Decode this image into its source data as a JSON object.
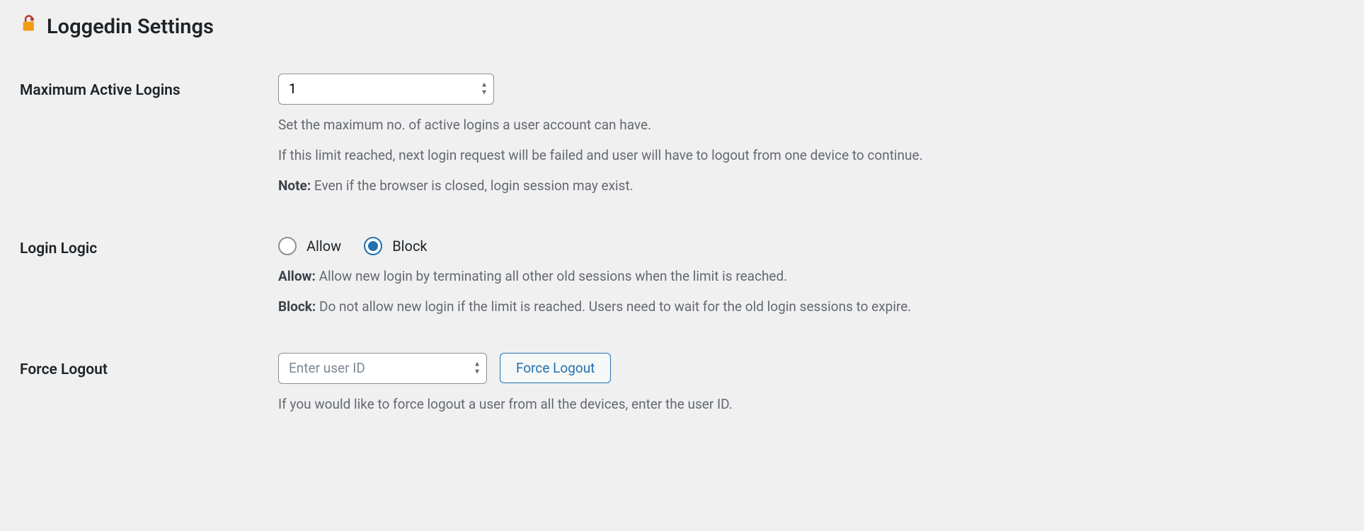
{
  "page": {
    "title": "Loggedin Settings"
  },
  "maxLogins": {
    "label": "Maximum Active Logins",
    "value": "1",
    "desc1": "Set the maximum no. of active logins a user account can have.",
    "desc2": "If this limit reached, next login request will be failed and user will have to logout from one device to continue.",
    "noteLabel": "Note:",
    "noteText": " Even if the browser is closed, login session may exist."
  },
  "loginLogic": {
    "label": "Login Logic",
    "allowOption": "Allow",
    "blockOption": "Block",
    "allowLabel": "Allow:",
    "allowText": " Allow new login by terminating all other old sessions when the limit is reached.",
    "blockLabel": "Block:",
    "blockText": " Do not allow new login if the limit is reached. Users need to wait for the old login sessions to expire."
  },
  "forceLogout": {
    "label": "Force Logout",
    "placeholder": "Enter user ID",
    "button": "Force Logout",
    "desc": "If you would like to force logout a user from all the devices, enter the user ID."
  }
}
